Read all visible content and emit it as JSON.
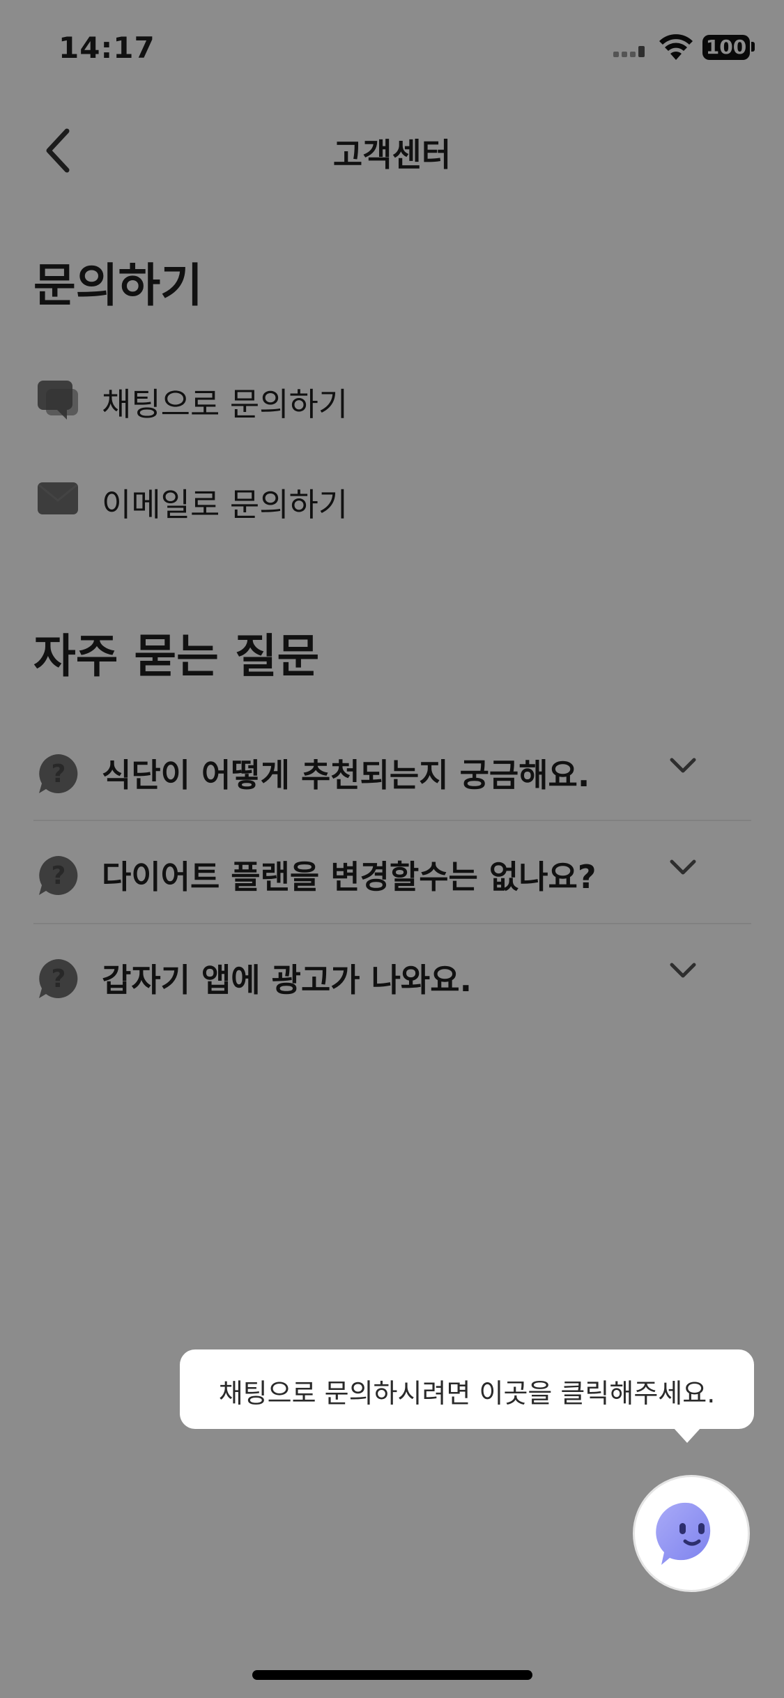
{
  "status_bar": {
    "time": "14:17",
    "battery": "100"
  },
  "nav": {
    "title": "고객센터"
  },
  "contact": {
    "title": "문의하기",
    "items": [
      {
        "label": "채팅으로 문의하기",
        "icon": "chat-bubble-icon"
      },
      {
        "label": "이메일로 문의하기",
        "icon": "envelope-icon"
      }
    ]
  },
  "faq": {
    "title": "자주 묻는 질문",
    "items": [
      {
        "question": "식단이 어떻게 추천되는지 궁금해요.",
        "icon": "question-bubble-icon"
      },
      {
        "question": "다이어트 플랜을 변경할수는 없나요?",
        "icon": "question-bubble-icon"
      },
      {
        "question": "갑자기 앱에 광고가 나와요.",
        "icon": "question-bubble-icon"
      }
    ]
  },
  "tooltip": {
    "text": "채팅으로 문의하시려면 이곳을 클릭해주세요."
  },
  "colors": {
    "overlay": "rgba(0,0,0,0.45)",
    "bot_face": "#8a8ef2",
    "text": "#1f1f1f"
  }
}
